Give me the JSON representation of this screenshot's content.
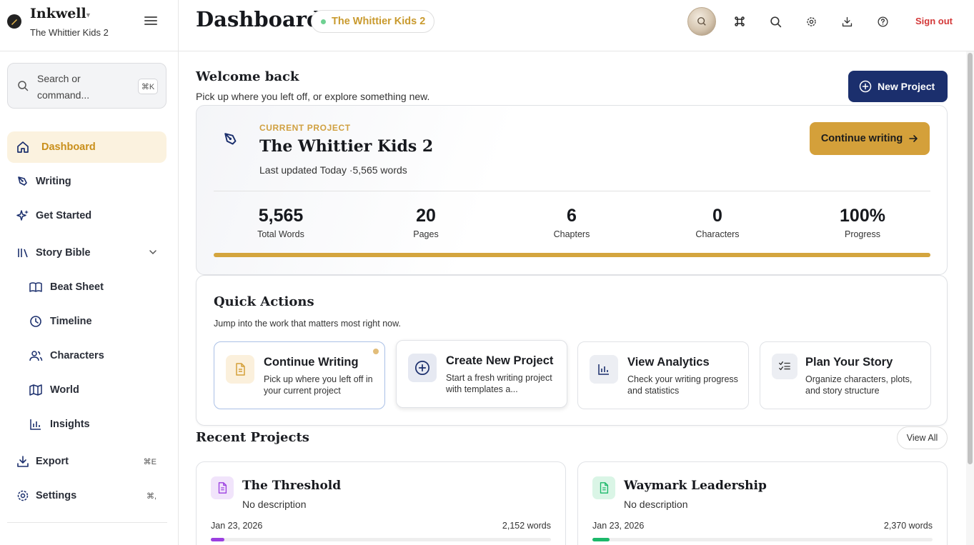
{
  "brand": {
    "name": "Inkwell",
    "project": "The Whittier Kids 2"
  },
  "search": {
    "placeholder": "Search or command...",
    "shortcut": "⌘K"
  },
  "nav": {
    "dashboard": "Dashboard",
    "writing": "Writing",
    "get_started": "Get Started",
    "story_bible": "Story Bible",
    "beat_sheet": "Beat Sheet",
    "timeline": "Timeline",
    "characters": "Characters",
    "world": "World",
    "insights": "Insights",
    "export": "Export",
    "export_shortcut": "⌘E",
    "settings": "Settings",
    "settings_shortcut": "⌘,"
  },
  "header": {
    "title": "Dashboard",
    "project_pill": "The Whittier Kids 2",
    "sign_out": "Sign out"
  },
  "welcome": {
    "title": "Welcome back",
    "subtitle": "Pick up where you left off, or explore something new.",
    "new_project": "New Project"
  },
  "current_project": {
    "label": "CURRENT PROJECT",
    "title": "The Whittier Kids 2",
    "meta": "Last updated Today ·5,565 words",
    "continue": "Continue writing",
    "progress": 1.0,
    "stats": [
      {
        "value": "5,565",
        "label": "Total Words"
      },
      {
        "value": "20",
        "label": "Pages"
      },
      {
        "value": "6",
        "label": "Chapters"
      },
      {
        "value": "0",
        "label": "Characters"
      },
      {
        "value": "100%",
        "label": "Progress"
      }
    ]
  },
  "quick_actions": {
    "title": "Quick Actions",
    "subtitle": "Jump into the work that matters most right now.",
    "items": [
      {
        "name": "Continue Writing",
        "desc": "Pick up where you left off in your current project"
      },
      {
        "name": "Create New Project",
        "desc": "Start a fresh writing project with templates a..."
      },
      {
        "name": "View Analytics",
        "desc": "Check your writing progress and statistics"
      },
      {
        "name": "Plan Your Story",
        "desc": "Organize characters, plots, and story structure"
      }
    ]
  },
  "recent": {
    "title": "Recent Projects",
    "view_all": "View All",
    "projects": [
      {
        "name": "The Threshold",
        "desc": "No description",
        "date": "Jan 23, 2026",
        "words": "2,152 words",
        "progress": 0.04,
        "color": "#9b3fe0"
      },
      {
        "name": "Waymark Leadership",
        "desc": "No description",
        "date": "Jan 23, 2026",
        "words": "2,370 words",
        "progress": 0.05,
        "color": "#1cb86a"
      }
    ]
  },
  "colors": {
    "accent": "#d4a03a",
    "primary": "#1b2f6d",
    "danger": "#d43939"
  }
}
